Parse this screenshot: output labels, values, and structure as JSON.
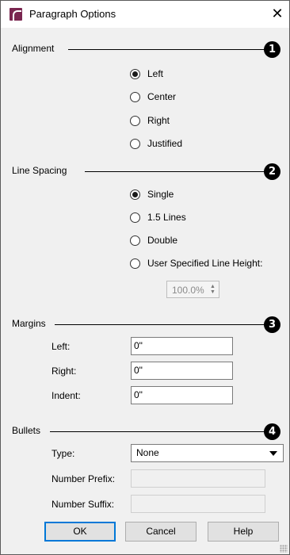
{
  "window": {
    "title": "Paragraph Options",
    "close_label": "✕",
    "app_icon": "chief-architect-icon"
  },
  "alignment": {
    "label": "Alignment",
    "badge": "1",
    "options": [
      {
        "label": "Left",
        "checked": true
      },
      {
        "label": "Center",
        "checked": false
      },
      {
        "label": "Right",
        "checked": false
      },
      {
        "label": "Justified",
        "checked": false
      }
    ]
  },
  "line_spacing": {
    "label": "Line Spacing",
    "badge": "2",
    "options": [
      {
        "label": "Single",
        "checked": true
      },
      {
        "label": "1.5 Lines",
        "checked": false
      },
      {
        "label": "Double",
        "checked": false
      },
      {
        "label": "User Specified Line Height:",
        "checked": false
      }
    ],
    "line_height_value": "100.0%"
  },
  "margins": {
    "label": "Margins",
    "badge": "3",
    "left_label": "Left:",
    "left_value": "0\"",
    "right_label": "Right:",
    "right_value": "0\"",
    "indent_label": "Indent:",
    "indent_value": "0\""
  },
  "bullets": {
    "label": "Bullets",
    "badge": "4",
    "type_label": "Type:",
    "type_value": "None",
    "prefix_label": "Number Prefix:",
    "prefix_value": "",
    "suffix_label": "Number Suffix:",
    "suffix_value": ""
  },
  "buttons": {
    "ok": "OK",
    "cancel": "Cancel",
    "help": "Help"
  },
  "colors": {
    "badge": "#000000",
    "dialog_bg": "#f0f0f0",
    "default_button_border": "#0078d7",
    "app_icon": "#7a2650"
  }
}
